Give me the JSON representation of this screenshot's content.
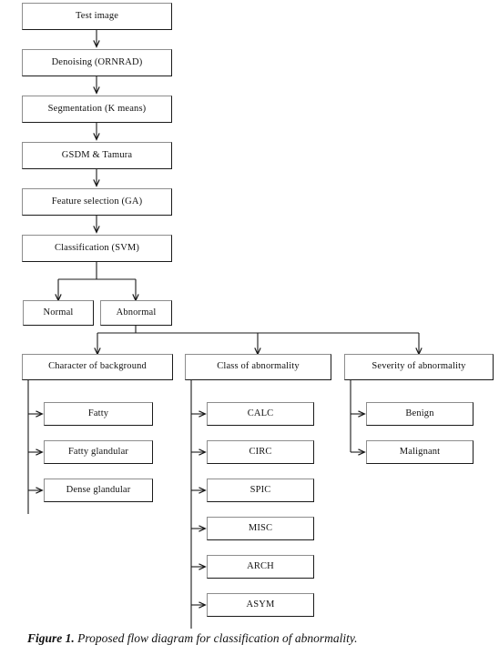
{
  "figure": {
    "label": "Figure 1.",
    "caption": " Proposed flow diagram for classification of abnormality."
  },
  "colors": {
    "box_border_light": "#8d8d8d",
    "box_border_dark": "#1a1a1a",
    "connector": "#1a1a1a",
    "background": "#ffffff",
    "text": "#111111"
  },
  "pipeline": [
    {
      "id": "test-image",
      "label": "Test image"
    },
    {
      "id": "denoising",
      "label": "Denoising (ORNRAD)"
    },
    {
      "id": "segmentation",
      "label": "Segmentation (K means)"
    },
    {
      "id": "gsdm-tamura",
      "label": "GSDM & Tamura"
    },
    {
      "id": "feature-selection",
      "label": "Feature selection (GA)"
    },
    {
      "id": "classification",
      "label": "Classification (SVM)"
    }
  ],
  "classification_outcomes": [
    {
      "id": "normal",
      "label": "Normal"
    },
    {
      "id": "abnormal",
      "label": "Abnormal"
    }
  ],
  "categories": [
    {
      "id": "character-of-background",
      "label": "Character of background",
      "items": [
        {
          "id": "fatty",
          "label": "Fatty"
        },
        {
          "id": "fatty-glandular",
          "label": "Fatty glandular"
        },
        {
          "id": "dense-glandular",
          "label": "Dense glandular"
        }
      ]
    },
    {
      "id": "class-of-abnormality",
      "label": "Class of abnormality",
      "items": [
        {
          "id": "calc",
          "label": "CALC"
        },
        {
          "id": "circ",
          "label": "CIRC"
        },
        {
          "id": "spic",
          "label": "SPIC"
        },
        {
          "id": "misc",
          "label": "MISC"
        },
        {
          "id": "arch",
          "label": "ARCH"
        },
        {
          "id": "asym",
          "label": "ASYM"
        }
      ]
    },
    {
      "id": "severity-of-abnormality",
      "label": "Severity of abnormality",
      "items": [
        {
          "id": "benign",
          "label": "Benign"
        },
        {
          "id": "malignant",
          "label": "Malignant"
        }
      ]
    }
  ]
}
